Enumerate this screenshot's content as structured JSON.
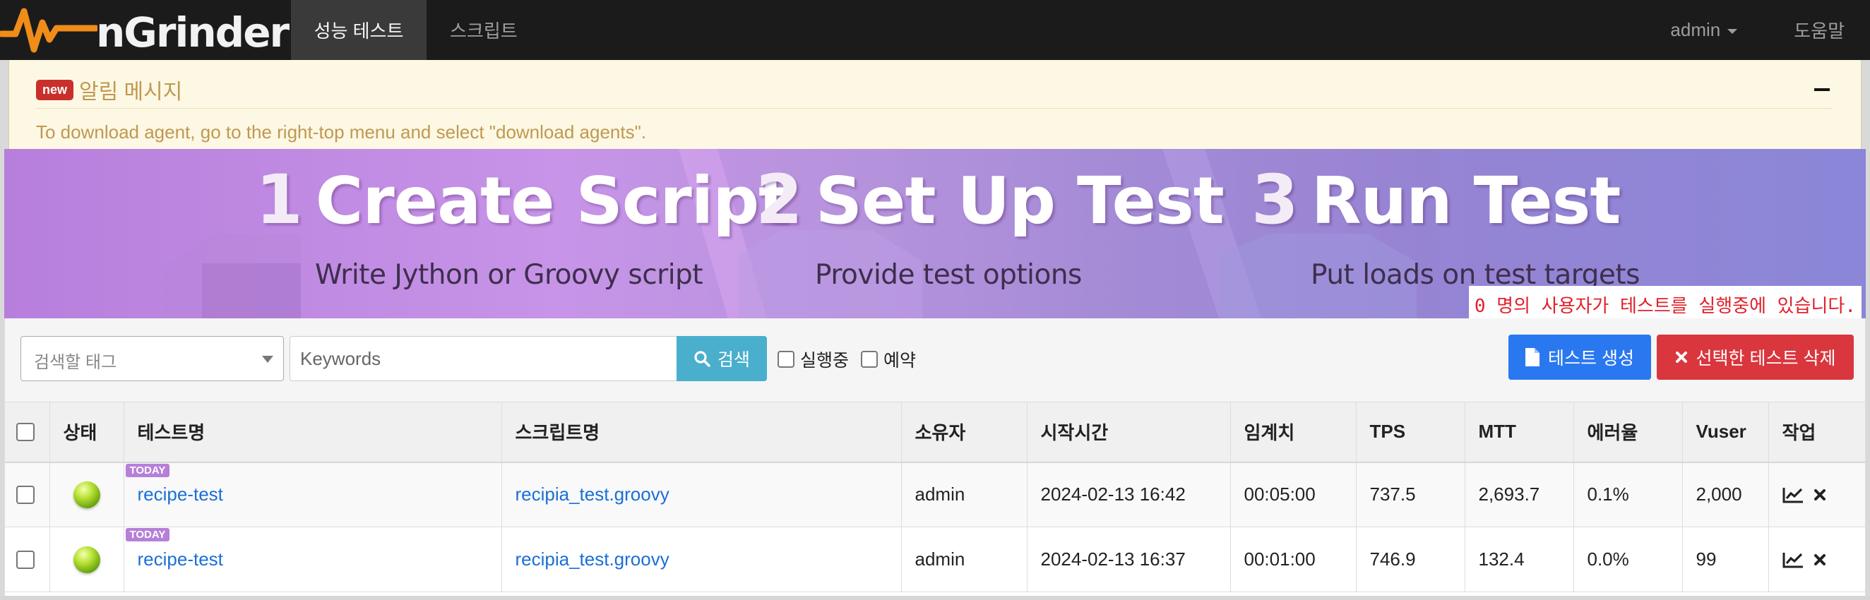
{
  "navbar": {
    "brand": "nGrinder",
    "tabs": [
      {
        "label": "성능 테스트",
        "active": true
      },
      {
        "label": "스크립트",
        "active": false
      }
    ],
    "user_menu": "admin",
    "help": "도움말"
  },
  "notice": {
    "badge": "new",
    "title": "알림 메시지",
    "text": "To download agent, go to the right-top menu and select \"download agents\"."
  },
  "banner": {
    "steps": [
      {
        "num": "1",
        "title": "Create Script",
        "subtitle": "Write Jython or Groovy script"
      },
      {
        "num": "2",
        "title": "Set Up Test",
        "subtitle": "Provide test options"
      },
      {
        "num": "3",
        "title": "Run Test",
        "subtitle": "Put loads on test targets"
      }
    ],
    "running_users": "0 명의 사용자가 테스트를 실행중에 있습니다."
  },
  "toolbar": {
    "tag_placeholder": "검색할 태그",
    "keywords_placeholder": "Keywords",
    "search_label": "검색",
    "running_filter": "실행중",
    "scheduled_filter": "예약",
    "create_label": "테스트 생성",
    "delete_label": "선택한 테스트 삭제"
  },
  "table": {
    "columns": [
      "상태",
      "테스트명",
      "스크립트명",
      "소유자",
      "시작시간",
      "임계치",
      "TPS",
      "MTT",
      "에러율",
      "Vuser",
      "작업"
    ],
    "rows": [
      {
        "badge": "TODAY",
        "test_name": "recipe-test",
        "script": "recipia_test.groovy",
        "owner": "admin",
        "start": "2024-02-13 16:42",
        "threshold": "00:05:00",
        "tps": "737.5",
        "mtt": "2,693.7",
        "error_rate": "0.1%",
        "vuser": "2,000"
      },
      {
        "badge": "TODAY",
        "test_name": "recipe-test",
        "script": "recipia_test.groovy",
        "owner": "admin",
        "start": "2024-02-13 16:37",
        "threshold": "00:01:00",
        "tps": "746.9",
        "mtt": "132.4",
        "error_rate": "0.0%",
        "vuser": "99"
      }
    ]
  },
  "colors": {
    "navbar": "#1b1b1b",
    "notice_bg": "#fcf8e3",
    "notice_text": "#c09853",
    "search_button": "#49afcd",
    "primary": "#2a78f0",
    "danger": "#d9363e",
    "link": "#1a6fd6",
    "status_ok": "#8fc31f"
  },
  "icons": {
    "logo": "ngrinder-pulse-logo",
    "search": "search-icon",
    "create": "file-icon",
    "delete": "close-icon",
    "status": "green-status-ball",
    "chart": "chart-icon",
    "remove": "remove-icon"
  }
}
